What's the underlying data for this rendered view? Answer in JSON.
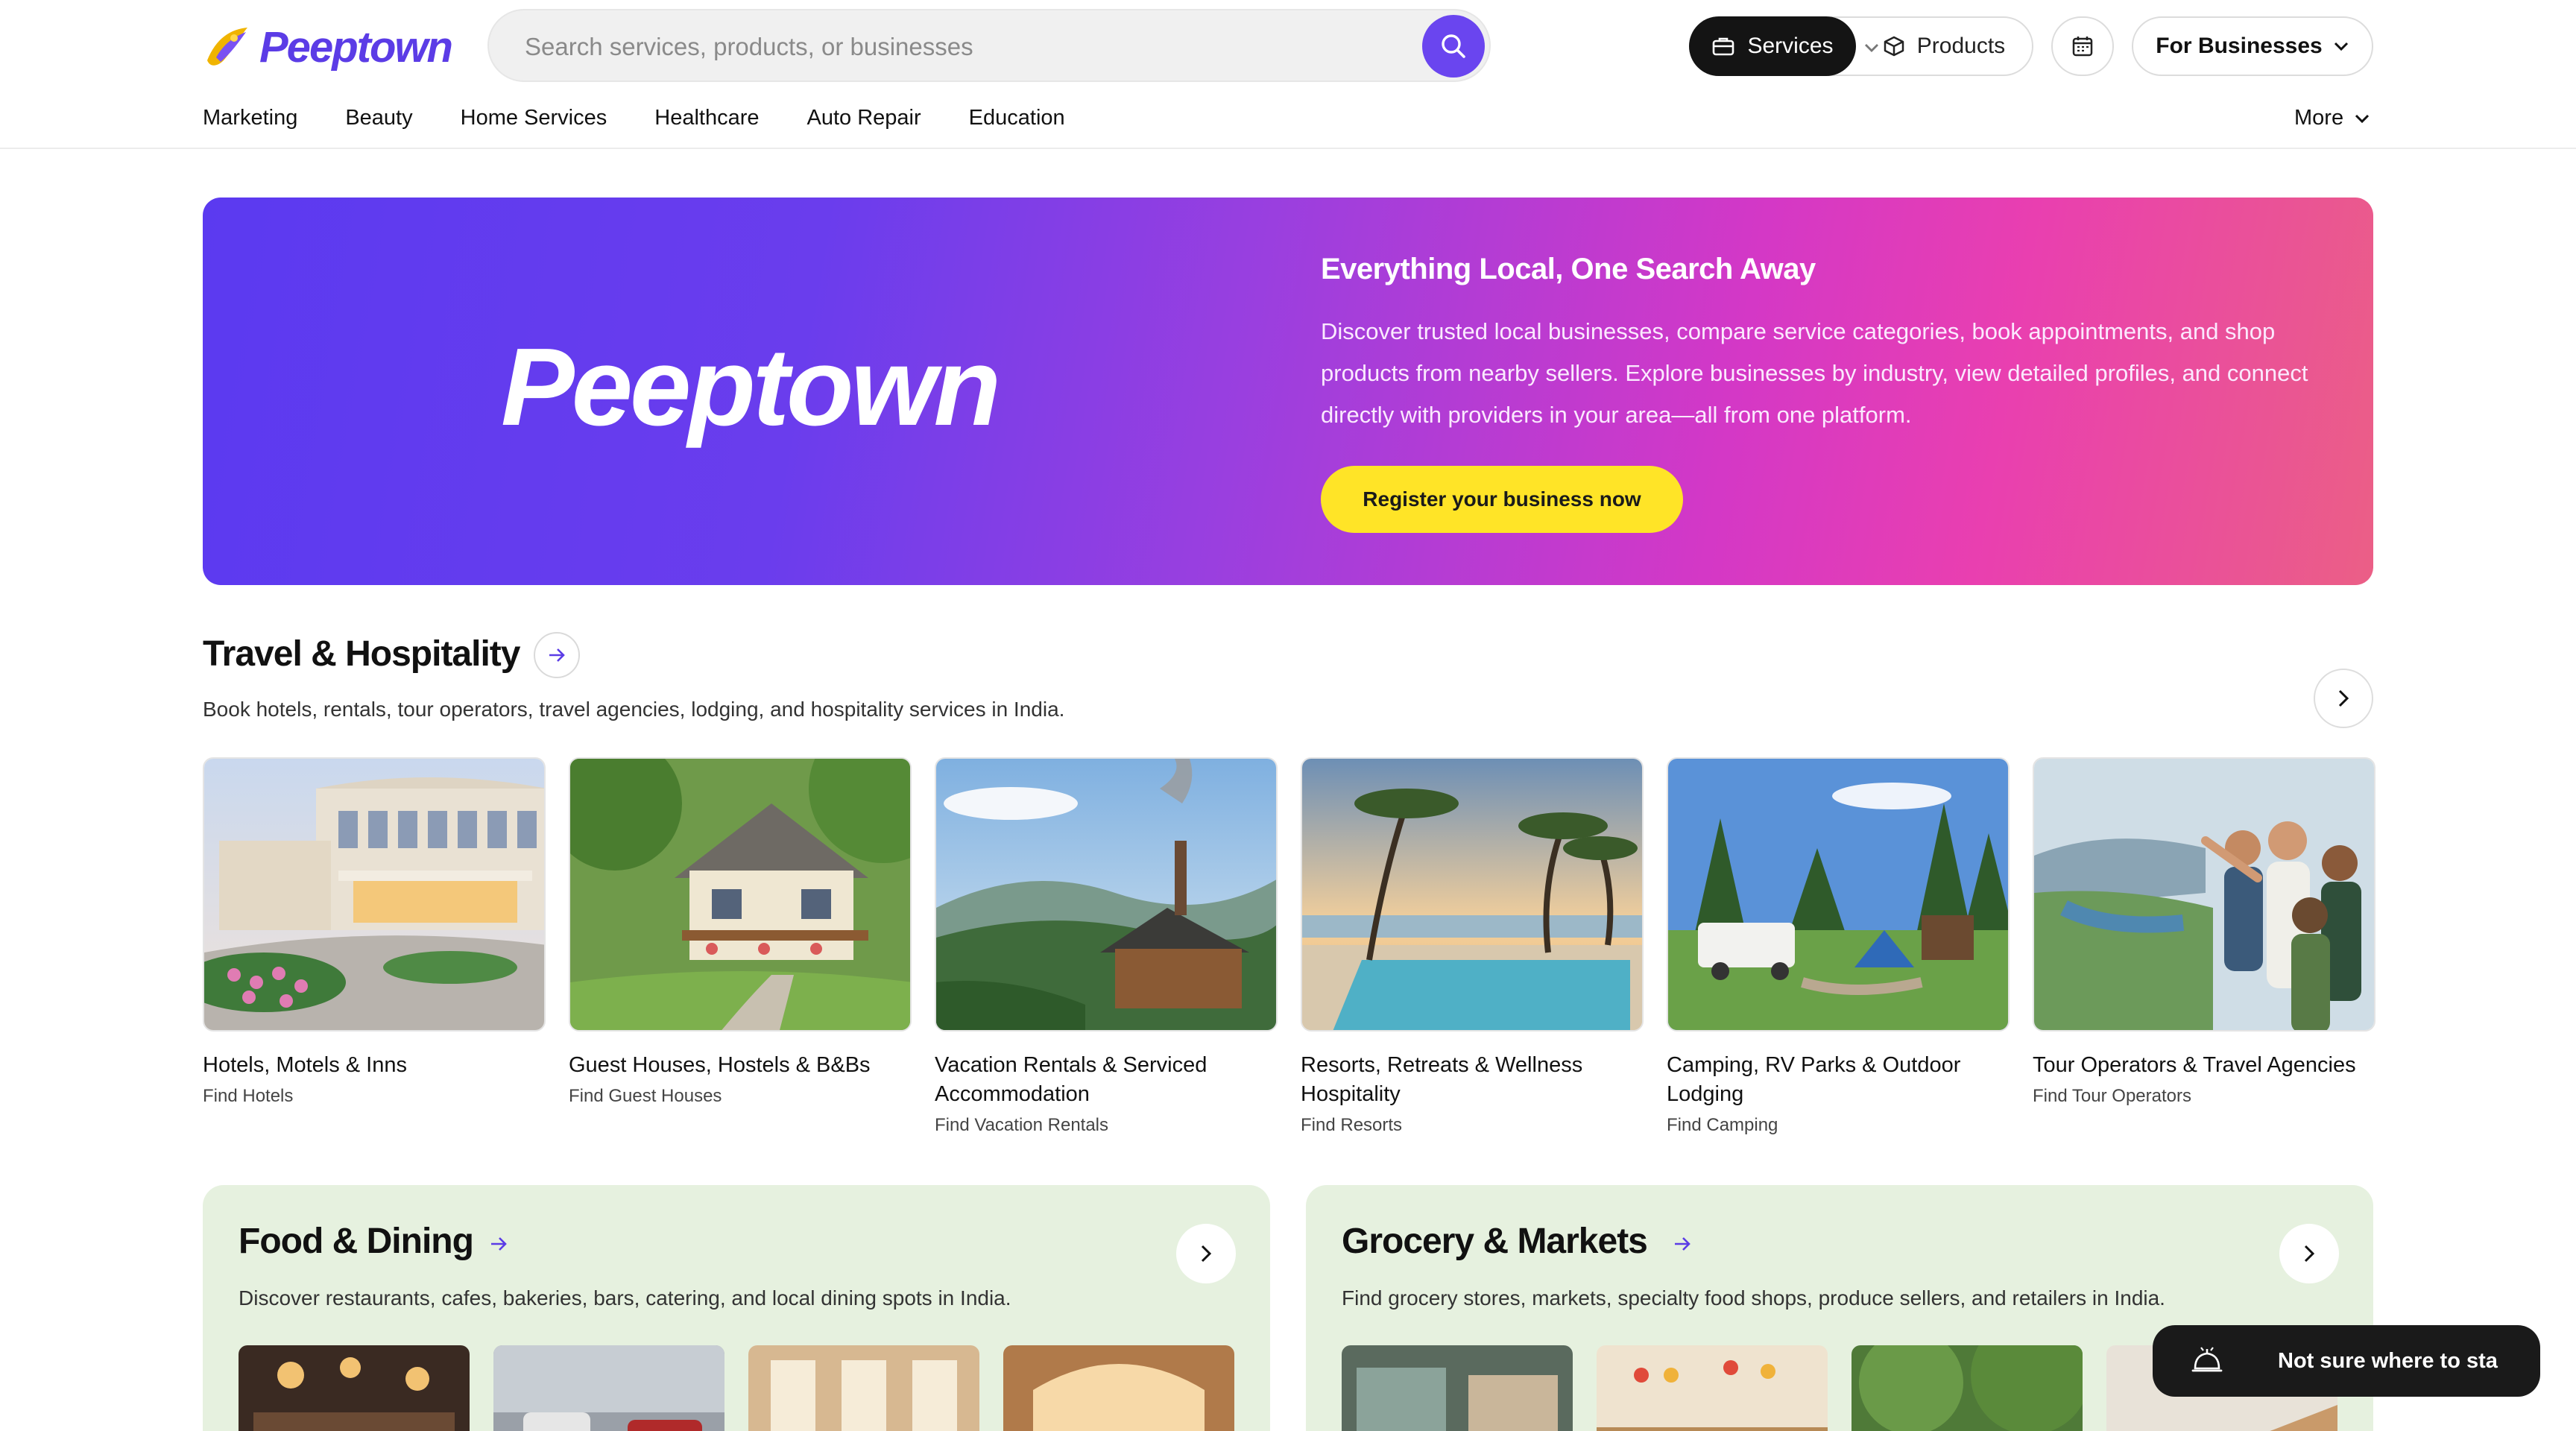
{
  "brand": {
    "name": "Peeptown",
    "color": "#5b3ce6"
  },
  "search": {
    "placeholder": "Search services, products, or businesses"
  },
  "header": {
    "services_label": "Services",
    "products_label": "Products",
    "for_businesses_label": "For Businesses"
  },
  "nav": {
    "items": [
      "Marketing",
      "Beauty",
      "Home Services",
      "Healthcare",
      "Auto Repair",
      "Education"
    ],
    "more_label": "More"
  },
  "hero": {
    "wordmark": "Peeptown",
    "title": "Everything Local, One Search Away",
    "description": "Discover trusted local businesses, compare service categories, book appointments, and shop products from nearby sellers. Explore businesses by industry, view detailed profiles, and connect directly with providers in your area—all from one platform.",
    "cta_label": "Register your business now",
    "cta_color": "#ffe427"
  },
  "travel": {
    "title": "Travel & Hospitality",
    "description": "Book hotels, rentals, tour operators, travel agencies, lodging, and hospitality services in India.",
    "cards": [
      {
        "title": "Hotels, Motels & Inns",
        "link": "Find Hotels",
        "image": "hotel-photo"
      },
      {
        "title": "Guest Houses, Hostels & B&Bs",
        "link": "Find Guest Houses",
        "image": "guest-house-photo"
      },
      {
        "title": "Vacation Rentals & Serviced Accommodation",
        "link": "Find Vacation Rentals",
        "image": "cabin-photo"
      },
      {
        "title": "Resorts, Retreats & Wellness Hospitality",
        "link": "Find Resorts",
        "image": "resort-pool-photo"
      },
      {
        "title": "Camping, RV Parks & Outdoor Lodging",
        "link": "Find Camping",
        "image": "campsite-photo"
      },
      {
        "title": "Tour Operators & Travel Agencies",
        "link": "Find Tour Operators",
        "image": "tour-group-photo"
      }
    ]
  },
  "food": {
    "title": "Food & Dining",
    "description": "Discover restaurants, cafes, bakeries, bars, catering, and local dining spots in India.",
    "panel_color": "#e6f1df"
  },
  "grocery": {
    "title": "Grocery & Markets",
    "description": "Find grocery stores, markets, specialty food shops, produce sellers, and retailers in India."
  },
  "toast": {
    "label": "Not sure where to sta"
  }
}
